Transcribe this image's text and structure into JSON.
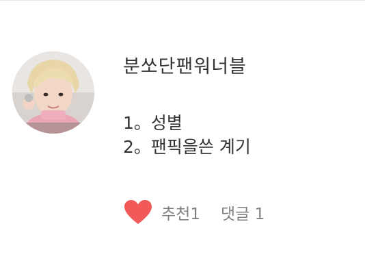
{
  "post": {
    "title": "분쏘단팬워너블",
    "lines": [
      "1。성별",
      "2。팬픽을쓴 계기"
    ]
  },
  "stats": {
    "recommend": "추천1",
    "comments": "댓글 1",
    "heart_color": "#f25a5a"
  },
  "icons": {
    "heart": "heart-icon",
    "avatar": "profile-avatar"
  }
}
